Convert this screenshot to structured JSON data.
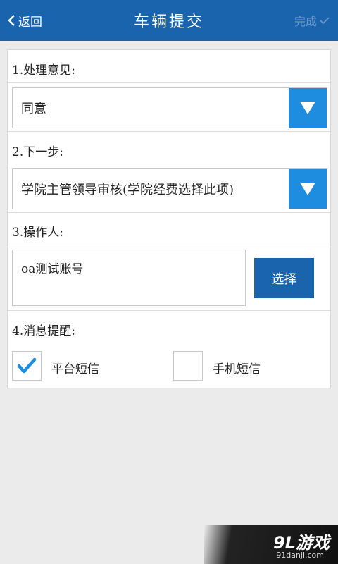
{
  "header": {
    "back_label": "返回",
    "title": "车辆提交",
    "done_label": "完成"
  },
  "form": {
    "opinion": {
      "label": "1.处理意见:",
      "value": "同意"
    },
    "next_step": {
      "label": "2.下一步:",
      "value": "学院主管领导审核(学院经费选择此项)"
    },
    "operator": {
      "label": "3.操作人:",
      "value": "oa测试账号",
      "choose_label": "选择"
    },
    "reminder": {
      "label": "4.消息提醒:",
      "options": [
        {
          "label": "平台短信",
          "checked": true
        },
        {
          "label": "手机短信",
          "checked": false
        }
      ]
    }
  },
  "watermark": {
    "logo": "9L游戏",
    "url": "91danji.com"
  },
  "colors": {
    "header_bg": "#1a63ad",
    "dropdown_arrow_bg": "#1e8de0",
    "button_bg": "#1a63ad",
    "check_color": "#1e8de0",
    "page_bg": "#ebebeb"
  }
}
